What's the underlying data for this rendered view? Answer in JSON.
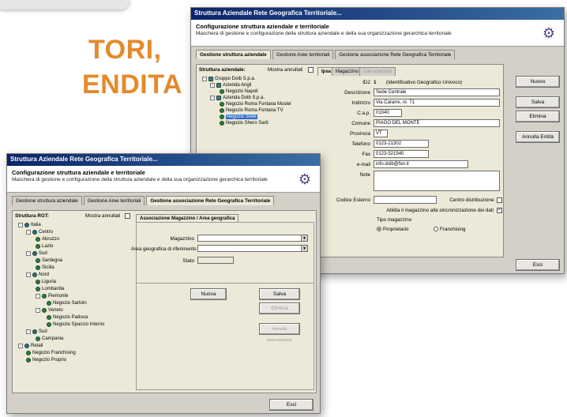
{
  "headline": {
    "line1": "TORI,",
    "line2": "ENDITA"
  },
  "back_window": {
    "title": "Struttura Aziendale Rete Geografica Territoriale...",
    "header_title": "Configurazione struttura aziendale e territoriale",
    "header_subtitle": "Maschera di gestione e configurazione della struttura aziendale e della sua organizzazione gerarchica territoriale",
    "tabs": [
      "Gestione struttura aziendale",
      "Gestione Aree territoriali",
      "Gestione associazione Rete Geografica Territoriale"
    ],
    "tree_label": "Struttura aziendale:",
    "show_cancelled_label": "Mostra annullati",
    "subtabs": [
      "Ipsa",
      "Magazzino",
      "Dati aziendali"
    ],
    "tree": [
      "Gruppo Dolb S.p.a.",
      "Azienda Arigli",
      "Negozio Napoli",
      "Azienda Dolb S.p.a.",
      "Negozio Roma Fontana Mosler",
      "Negozio Roma Fontana TV",
      "Negozio Sede",
      "Negozio Shero Sarti"
    ],
    "fields": {
      "id_label": "ID2",
      "id_value": "1",
      "id_hint": "(Identificativo Geografico Univoco)",
      "descr_label": "Descrizione",
      "descr_value": "Sede Centrale",
      "addr_label": "Indirizzo",
      "addr_value": "Via Cararre, nr. 71",
      "cap_label": "C.a.p.",
      "cap_value": "01040",
      "comune_label": "Comune",
      "comune_value": "PIAGO DEL MONTE",
      "prov_label": "Provincia",
      "prov_value": "VT",
      "tel_label": "Telefono",
      "tel_value": "0123-21302",
      "fax_label": "Fax",
      "fax_value": "0123-521540",
      "email_label": "e-mail",
      "email_value": "info.dolb@fen.it",
      "note_label": "Note",
      "ext_code_label": "Codice Esterno",
      "dist_center_label": "Centro distribuzione:",
      "sync_label": "Abilita il magazzino alla sincronizzazione dei dati",
      "type_label": "Tipo magazzino",
      "type_opt1": "Proprietario",
      "type_opt2": "Franchising"
    },
    "buttons": {
      "new": "Nuovo",
      "save": "Salva",
      "delete": "Elimina",
      "cancel_entity": "Annulla Entità",
      "exit": "Esci"
    }
  },
  "front_window": {
    "title": "Struttura Aziendale Rete Geografica Territoriale...",
    "header_title": "Configurazione struttura aziendale e territoriale",
    "header_subtitle": "Maschera di gestione e configurazione della struttura aziendale e della sua organizzazione gerarchica territoriale",
    "tabs": [
      "Gestione struttura aziendale",
      "Gestione Aree territoriali",
      "Gestione associazione Rete Geografica Territoriale"
    ],
    "tree_label": "Struttura RGT:",
    "show_cancelled_label": "Mostra annullati",
    "subtab": "Associazione Magazzino / Area geografica",
    "tree": [
      "Italia",
      "Centro",
      "Abruzzo",
      "Lazio",
      "Sud",
      "Sardegna",
      "Sicilia",
      "Nord",
      "Liguria",
      "Lombardia",
      "Piemonte",
      "Negozio Sartoin",
      "Veneto",
      "Negozio Padova",
      "Negozio Spaccio Interno",
      "Sud",
      "Campania",
      "Retail",
      "Negozio Franchising",
      "Negozio Proprio"
    ],
    "warehouse_label": "Magazzino",
    "area_label": "Area geografica di riferimento",
    "state_label": "Stato",
    "buttons": {
      "new": "Nuova",
      "save": "Salva",
      "delete": "Elimina",
      "cancel_assoc": "Annulla associazione",
      "exit": "Esci"
    }
  }
}
